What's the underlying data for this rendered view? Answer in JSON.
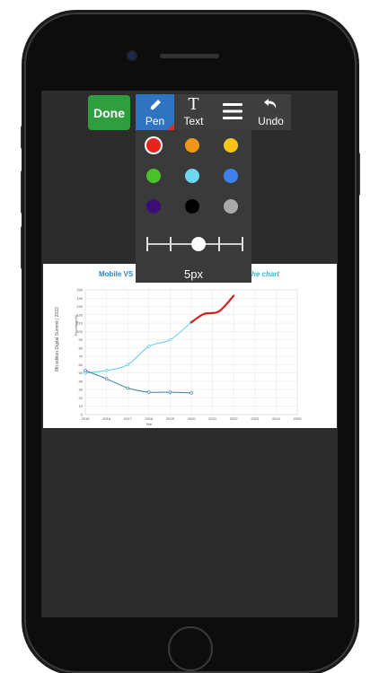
{
  "toolbar": {
    "done_label": "Done",
    "tools": [
      {
        "label": "Pen",
        "icon": "pen-icon",
        "active": true
      },
      {
        "label": "Text",
        "icon": "text-icon",
        "glyph": "T"
      },
      {
        "label": "",
        "icon": "menu-icon"
      },
      {
        "label": "Undo",
        "icon": "undo-icon"
      }
    ]
  },
  "pen_panel": {
    "colors": [
      "#e8231f",
      "#f0961a",
      "#f5c518",
      "#4cc22a",
      "#6fd6f2",
      "#3d80f0",
      "#3a0f75",
      "#000000",
      "#a8a8a8"
    ],
    "selected_color": "#e8231f",
    "size_value": 5,
    "size_label": "5px"
  },
  "chart": {
    "title_left": "Mobile VS",
    "title_right": "he chart",
    "side_label": "8th edition Digital Summit | 2022",
    "ylabel": "Percentage(%)",
    "xlabel": "Year"
  },
  "chart_data": {
    "type": "line",
    "x": [
      2015,
      2016,
      2017,
      2018,
      2019,
      2020
    ],
    "xticks": [
      "2015",
      "2016",
      "2017",
      "2018",
      "2019",
      "2020",
      "2021",
      "2022",
      "2023",
      "2024",
      "2025"
    ],
    "yticks": [
      "0",
      "10",
      "20",
      "30",
      "40",
      "50",
      "60",
      "70",
      "80",
      "90",
      "100",
      "110",
      "120",
      "130",
      "140",
      "150"
    ],
    "xlim": [
      2015,
      2025
    ],
    "ylim": [
      0,
      150
    ],
    "grid": true,
    "series": [
      {
        "color": "#5fcbe3",
        "values": [
          50,
          53,
          60,
          82,
          90,
          111
        ]
      },
      {
        "color": "#3a7fb0",
        "values": [
          53,
          43,
          32,
          27,
          27,
          26
        ]
      }
    ],
    "annotation": {
      "color": "#d0231c",
      "x": [
        2020,
        2020.6,
        2021.3,
        2022
      ],
      "y": [
        111,
        121,
        124,
        143
      ]
    }
  }
}
